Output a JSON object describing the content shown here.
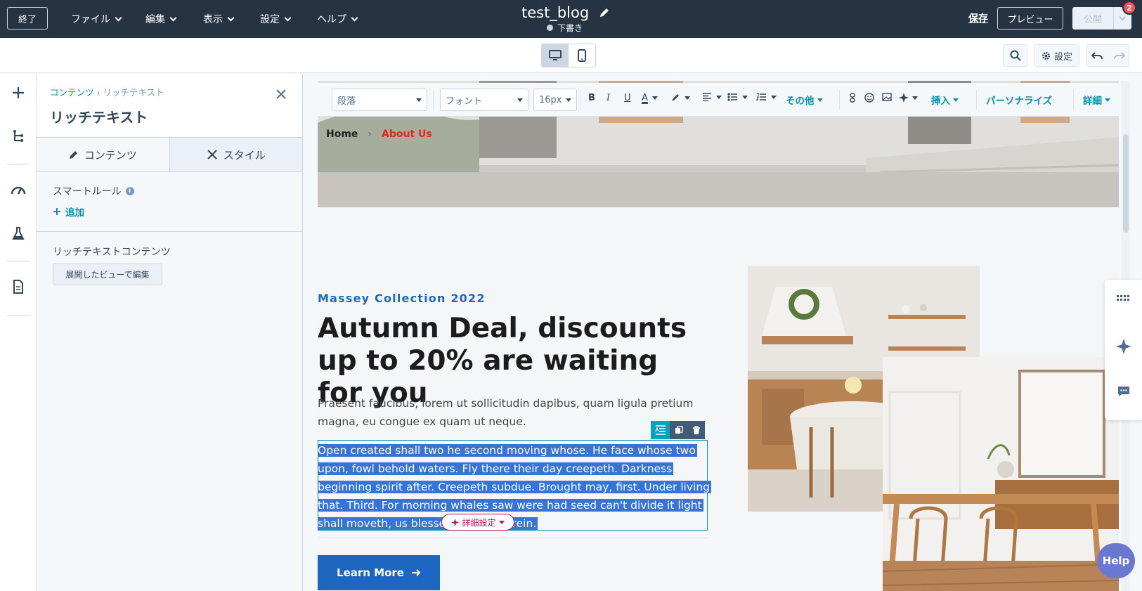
{
  "topbar": {
    "exit_label": "終了",
    "menus": [
      {
        "label": "ファイル"
      },
      {
        "label": "編集"
      },
      {
        "label": "表示"
      },
      {
        "label": "設定"
      },
      {
        "label": "ヘルプ"
      }
    ],
    "doc_title": "test_blog",
    "status": "下書き",
    "save_label": "保存",
    "preview_label": "プレビュー",
    "publish_label": "公開",
    "notification_count": "2"
  },
  "subbar": {
    "settings_label": "設定"
  },
  "panel": {
    "breadcrumb_parent": "コンテンツ",
    "breadcrumb_current": "リッチテキスト",
    "title": "リッチテキスト",
    "tab_content": "コンテンツ",
    "tab_style": "スタイル",
    "smart_rule_label": "スマートルール",
    "add_label": "追加",
    "rich_text_label": "リッチテキストコンテンツ",
    "expand_button": "展開したビューで編集"
  },
  "toolbar": {
    "paragraph": "段落",
    "font": "フォント",
    "size": "16px",
    "more": "その他",
    "insert": "挿入",
    "personalize": "パーソナライズ",
    "details": "詳細"
  },
  "page": {
    "breadcrumb_home": "Home",
    "breadcrumb_current": "About Us",
    "eyebrow": "Massey Collection 2022",
    "headline": "Autumn Deal, discounts up to 20% are waiting for you",
    "lead": "Praesent faucibus, lorem ut sollicitudin dapibus, quam ligula pretium magna, eu congue ex quam ut neque.",
    "selected_text": "Open created shall two he second moving whose. He face whose two upon, fowl behold waters. Fly there their day creepeth. Darkness beginning spirit after. Creepeth subdue. Brought may, first. Under living that. Third. For morning whales saw were had seed can't divide it light shall moveth, us blessed given wherein.",
    "ai_settings_label": "詳細設定",
    "cta_label": "Learn More"
  },
  "help_label": "Help",
  "colors": {
    "topbar": "#253342",
    "accent": "#0091ae",
    "selection": "#3873d6",
    "cta": "#1e67c0",
    "breadcrumb_active": "#e3261b"
  }
}
